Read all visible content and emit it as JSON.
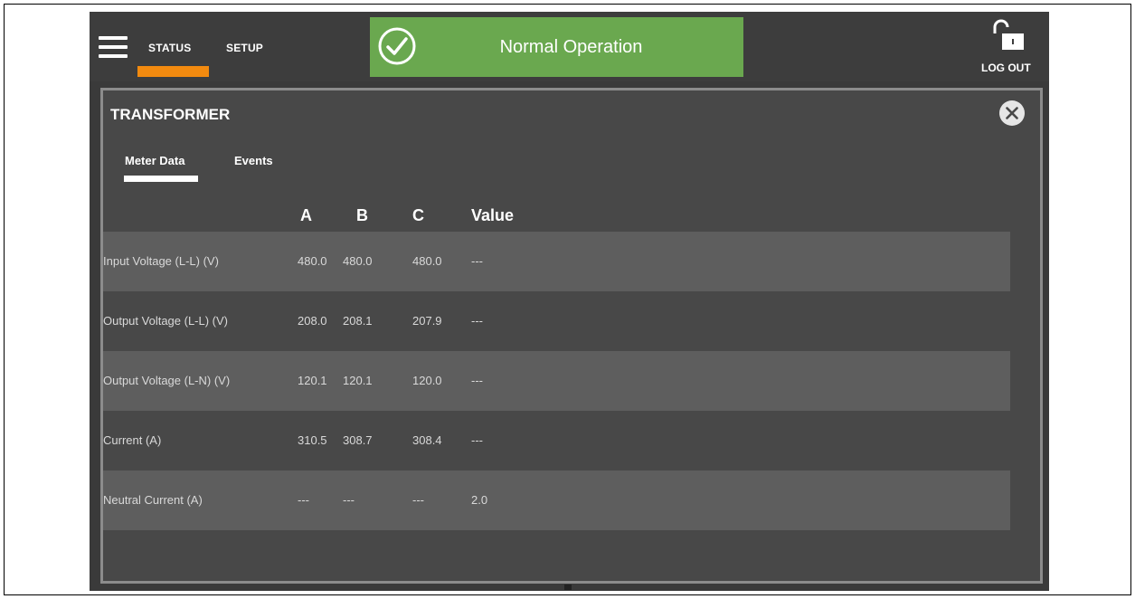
{
  "nav": {
    "tabs": [
      "STATUS",
      "SETUP"
    ],
    "active": "STATUS"
  },
  "status": {
    "text": "Normal Operation",
    "color": "#6aa84f",
    "icon": "check-circle-icon"
  },
  "header_right": {
    "lock_icon": "unlocked-padlock-icon",
    "logout_label": "LOG OUT"
  },
  "panel": {
    "title": "TRANSFORMER",
    "close_icon": "close-circle-icon",
    "tabs": [
      "Meter Data",
      "Events"
    ],
    "active_tab": "Meter Data"
  },
  "table": {
    "headers": [
      "A",
      "B",
      "C",
      "Value"
    ],
    "rows": [
      {
        "label": "Input Voltage (L-L) (V)",
        "a": "480.0",
        "b": "480.0",
        "c": "480.0",
        "value": "---"
      },
      {
        "label": "Output Voltage (L-L) (V)",
        "a": "208.0",
        "b": "208.1",
        "c": "207.9",
        "value": "---"
      },
      {
        "label": "Output Voltage (L-N) (V)",
        "a": "120.1",
        "b": "120.1",
        "c": "120.0",
        "value": "---"
      },
      {
        "label": "Current (A)",
        "a": "310.5",
        "b": "308.7",
        "c": "308.4",
        "value": "---"
      },
      {
        "label": "Neutral Current (A)",
        "a": "---",
        "b": "---",
        "c": "---",
        "value": "2.0"
      }
    ]
  },
  "colors": {
    "accent_orange": "#f28a0f",
    "status_green": "#6aa84f"
  }
}
